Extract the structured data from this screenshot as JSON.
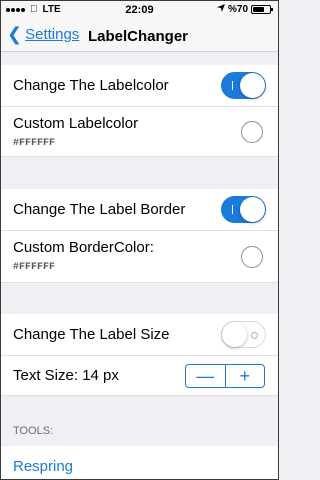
{
  "statusbar": {
    "carrier": "LTE",
    "time": "22:09",
    "battery": "%70",
    "battery_level": 0.7
  },
  "navbar": {
    "back_label": "Settings",
    "title": "LabelChanger"
  },
  "section1": {
    "change_label": "Change The Labelcolor",
    "change_on": true,
    "custom_label": "Custom Labelcolor",
    "custom_value": "#FFFFFF"
  },
  "section2": {
    "change_label": "Change The Label Border",
    "change_on": true,
    "custom_label": "Custom BorderColor:",
    "custom_value": "#FFFFFF"
  },
  "section3": {
    "size_label": "Change The Label Size",
    "size_on": false,
    "text_size_label": "Text Size: 14 px",
    "minus": "—",
    "plus": "+"
  },
  "tools": {
    "header": "TOOLS:",
    "respring": "Respring"
  }
}
